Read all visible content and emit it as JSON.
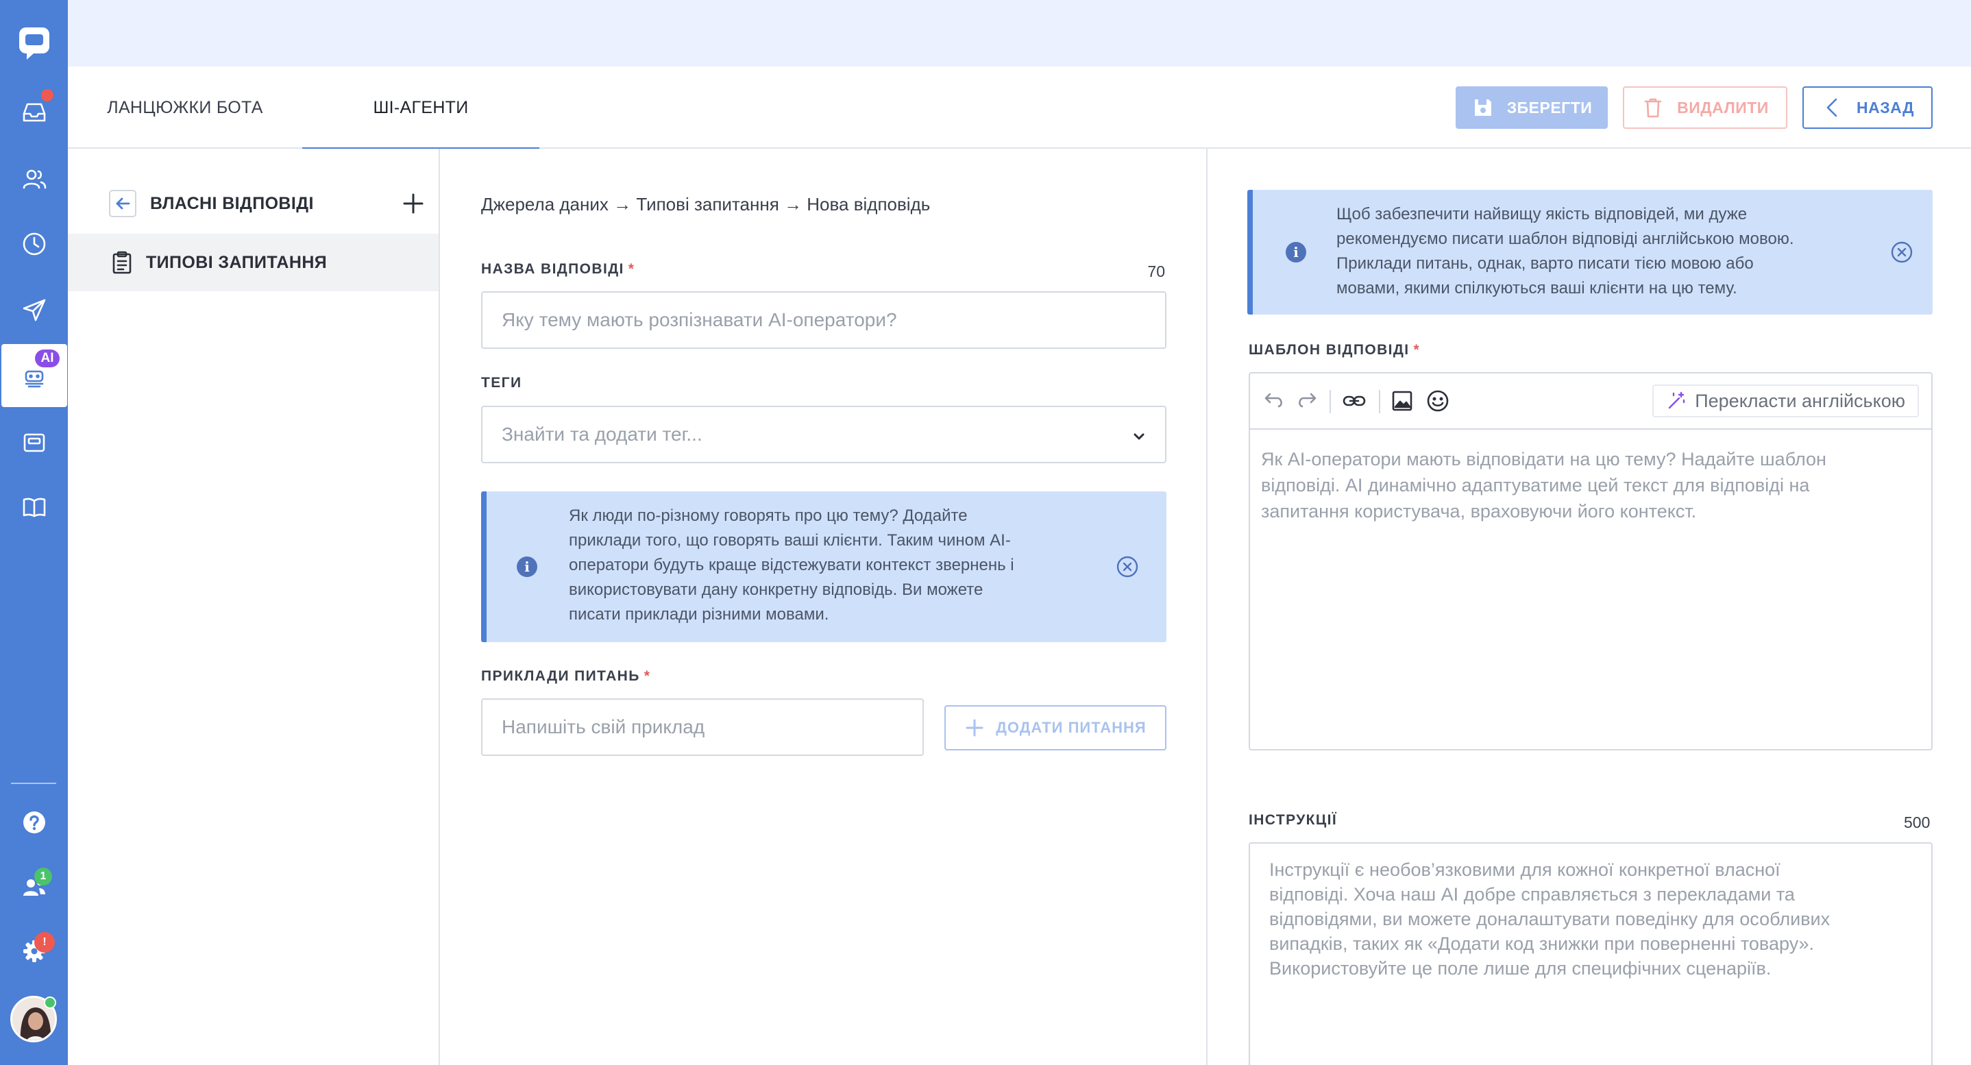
{
  "tabs": [
    {
      "label": "ЛАНЦЮЖКИ БОТА"
    },
    {
      "label": "ШІ-АГЕНТИ"
    }
  ],
  "toolbar": {
    "save_label": "ЗБЕРЕГТИ",
    "delete_label": "ВИДАЛИТИ",
    "back_label": "НАЗАД"
  },
  "rail": {
    "ai_badge": "AI",
    "team_badge": "1",
    "settings_badge": "!"
  },
  "list": {
    "title": "ВЛАСНІ ВІДПОВІДІ",
    "items": [
      {
        "label": "ТИПОВІ ЗАПИТАННЯ"
      }
    ]
  },
  "form": {
    "breadcrumb": "Джерела даних → Типові запитання → Нова відповідь",
    "name": {
      "label": "НАЗВА ВІДПОВІДІ",
      "required": "*",
      "counter": "70",
      "placeholder": "Яку тему мають розпізнавати AI-оператори?"
    },
    "tags": {
      "label": "ТЕГИ",
      "placeholder": "Знайти та додати тег..."
    },
    "info": {
      "lines": [
        "Як люди по-різному говорять про цю тему? Додайте",
        "приклади того, що говорять ваші клієнти. Таким чином AI-",
        "оператори будуть краще відстежувати контекст звернень і",
        "використовувати дану конкретну відповідь. Ви можете",
        "писати приклади різними мовами."
      ]
    },
    "examples": {
      "label": "ПРИКЛАДИ ПИТАНЬ",
      "required": "*",
      "placeholder": "Напишіть свій приклад",
      "add_label": "ДОДАТИ ПИТАННЯ"
    }
  },
  "right": {
    "info": {
      "lines": [
        "Щоб забезпечити найвищу якість відповідей, ми дуже",
        "рекомендуємо писати шаблон відповіді англійською мовою.",
        "Приклади питань, однак, варто писати тією мовою або",
        "мовами, якими спілкуються ваші клієнти на цю тему."
      ]
    },
    "template": {
      "label": "ШАБЛОН ВІДПОВІДІ",
      "required": "*",
      "translate_label": "Перекласти англійською",
      "placeholder_lines": [
        "Як AI-оператори мають відповідати на цю тему? Надайте шаблон",
        "відповіді. AI динамічно адаптуватиме цей текст для відповіді на",
        "запитання користувача, враховуючи його контекст."
      ]
    },
    "instructions": {
      "label": "ІНСТРУКЦІЇ",
      "counter": "500",
      "placeholder_lines": [
        "Інструкції є необов’язковими для кожної конкретної власної",
        "відповіді. Хоча наш AI добре справляється з перекладами та",
        "відповідями, ви можете доналаштувати поведінку для особливих",
        "випадків, таких як «Додати код знижки при поверненні товару».",
        "Використовуйте це поле лише для специфічних сценаріїв."
      ]
    }
  },
  "colors": {
    "brand": "#4c7fd6",
    "info_bg": "#cfe0fb",
    "ai_badge": "#8a4ee6",
    "alert_dot": "#ee5a52",
    "online": "#4bc36b"
  }
}
